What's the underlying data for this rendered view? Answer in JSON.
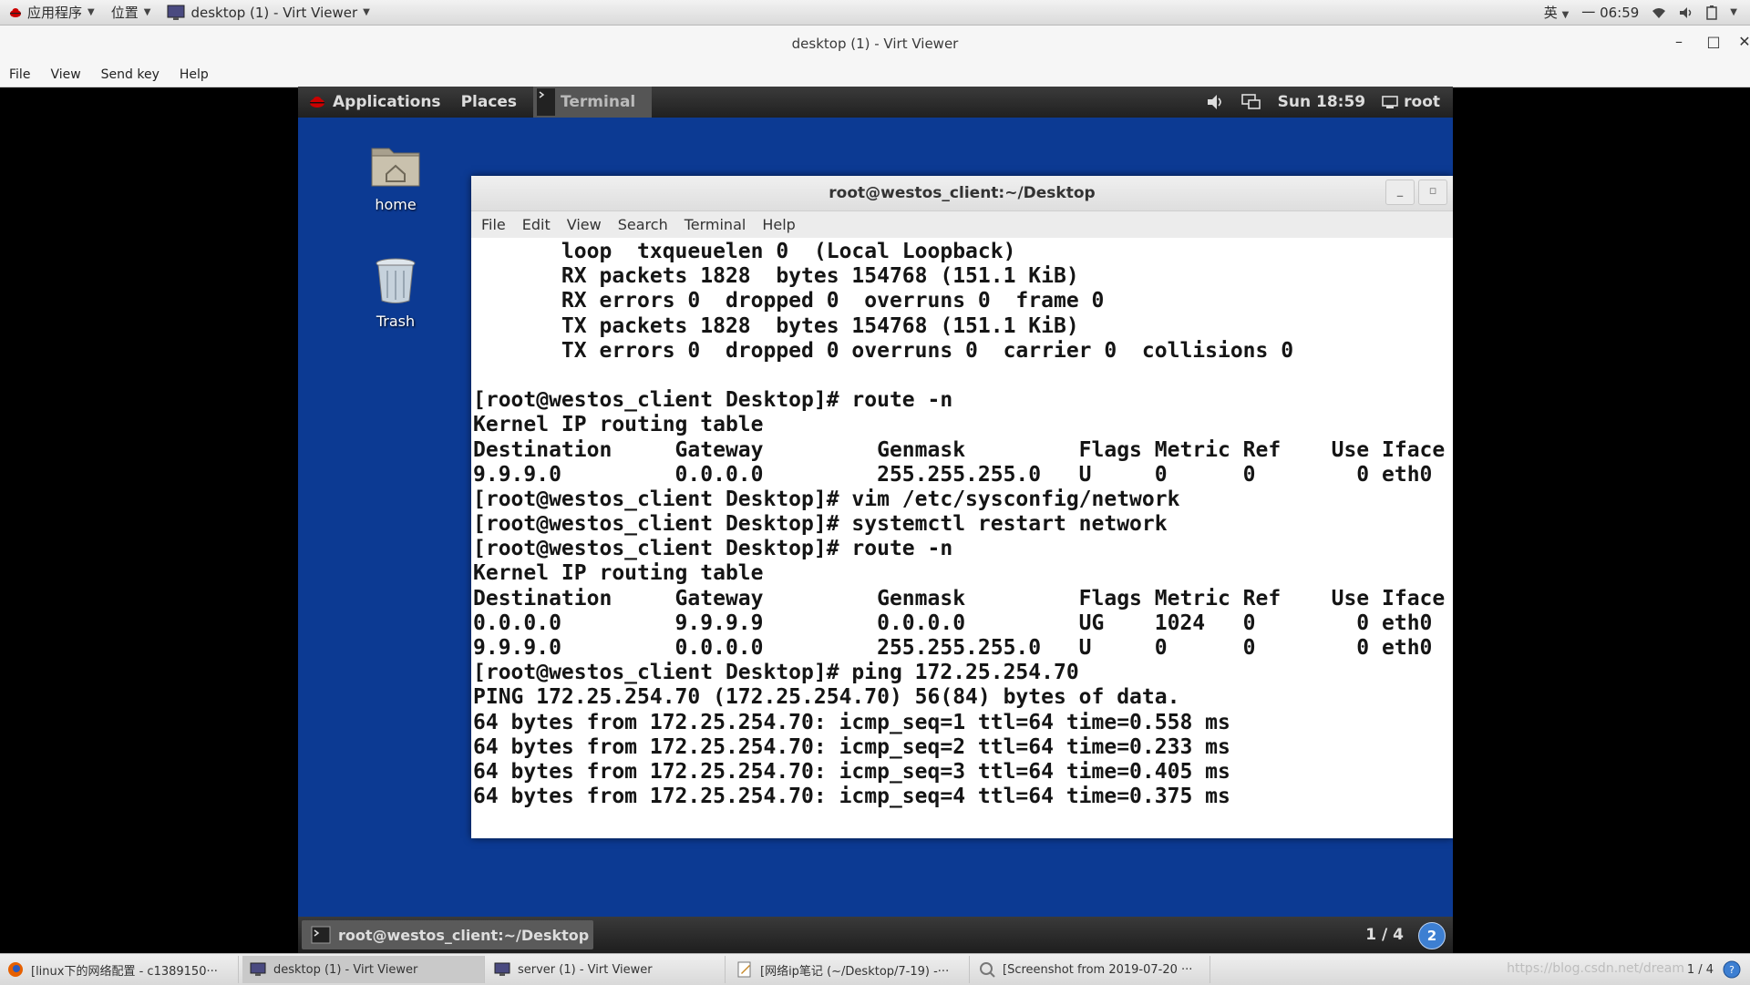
{
  "host_top": {
    "apps_label": "应用程序",
    "places_label": "位置",
    "window_label": "desktop (1) - Virt Viewer",
    "input_method": "英",
    "clock": "一 06:59"
  },
  "vv_window": {
    "title": "desktop (1) - Virt Viewer",
    "menu": [
      "File",
      "View",
      "Send key",
      "Help"
    ],
    "minimize": "–",
    "maximize": "□",
    "close": "✕"
  },
  "guest_top": {
    "applications": "Applications",
    "places": "Places",
    "terminal_task": "Terminal",
    "clock": "Sun 18:59",
    "user": "root"
  },
  "desktop_icons": {
    "home": "home",
    "trash": "Trash"
  },
  "terminal": {
    "title": "root@westos_client:~/Desktop",
    "menu": [
      "File",
      "Edit",
      "View",
      "Search",
      "Terminal",
      "Help"
    ],
    "lines": [
      "       loop  txqueuelen 0  (Local Loopback)",
      "       RX packets 1828  bytes 154768 (151.1 KiB)",
      "       RX errors 0  dropped 0  overruns 0  frame 0",
      "       TX packets 1828  bytes 154768 (151.1 KiB)",
      "       TX errors 0  dropped 0 overruns 0  carrier 0  collisions 0",
      "",
      "[root@westos_client Desktop]# route -n",
      "Kernel IP routing table",
      "Destination     Gateway         Genmask         Flags Metric Ref    Use Iface",
      "9.9.9.0         0.0.0.0         255.255.255.0   U     0      0        0 eth0",
      "[root@westos_client Desktop]# vim /etc/sysconfig/network",
      "[root@westos_client Desktop]# systemctl restart network",
      "[root@westos_client Desktop]# route -n",
      "Kernel IP routing table",
      "Destination     Gateway         Genmask         Flags Metric Ref    Use Iface",
      "0.0.0.0         9.9.9.9         0.0.0.0         UG    1024   0        0 eth0",
      "9.9.9.0         0.0.0.0         255.255.255.0   U     0      0        0 eth0",
      "[root@westos_client Desktop]# ping 172.25.254.70",
      "PING 172.25.254.70 (172.25.254.70) 56(84) bytes of data.",
      "64 bytes from 172.25.254.70: icmp_seq=1 ttl=64 time=0.558 ms",
      "64 bytes from 172.25.254.70: icmp_seq=2 ttl=64 time=0.233 ms",
      "64 bytes from 172.25.254.70: icmp_seq=3 ttl=64 time=0.405 ms",
      "64 bytes from 172.25.254.70: icmp_seq=4 ttl=64 time=0.375 ms"
    ]
  },
  "guest_bottom": {
    "task_label": "root@westos_client:~/Desktop",
    "workspace": "1 / 4",
    "badge": "2"
  },
  "host_bottom": {
    "tasks": [
      "[linux下的网络配置 - c1389150···",
      "desktop (1) - Virt Viewer",
      "server (1) - Virt Viewer",
      "[网络ip笔记 (~/Desktop/7-19) -···",
      "[Screenshot from 2019-07-20 ···"
    ],
    "workspace": "1 / 4",
    "watermark": "https://blog.csdn.net/dream"
  },
  "colors": {
    "guest_desktop": "#0c3a93",
    "terminal_bg": "#ffffff",
    "panel_dark": "#2a2a2a"
  }
}
